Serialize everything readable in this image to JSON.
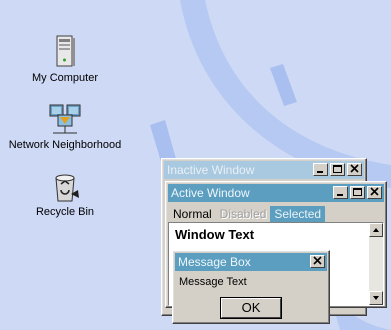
{
  "desktop": {
    "icons": [
      {
        "label": "My Computer",
        "icon": "computer-icon"
      },
      {
        "label": "Network Neighborhood",
        "icon": "network-icon"
      },
      {
        "label": "Recycle Bin",
        "icon": "recycle-bin-icon"
      }
    ],
    "background_color": "#ced9f5",
    "accent_color": "#b3c6f0"
  },
  "inactive_window": {
    "title": "Inactive Window",
    "title_color": "#a9c9e0"
  },
  "active_window": {
    "title": "Active Window",
    "title_color": "#5b9ec0",
    "menu": {
      "normal": "Normal",
      "disabled": "Disabled",
      "selected": "Selected"
    },
    "window_text": "Window Text"
  },
  "message_box": {
    "title": "Message Box",
    "text": "Message Text",
    "ok_label": "OK"
  }
}
